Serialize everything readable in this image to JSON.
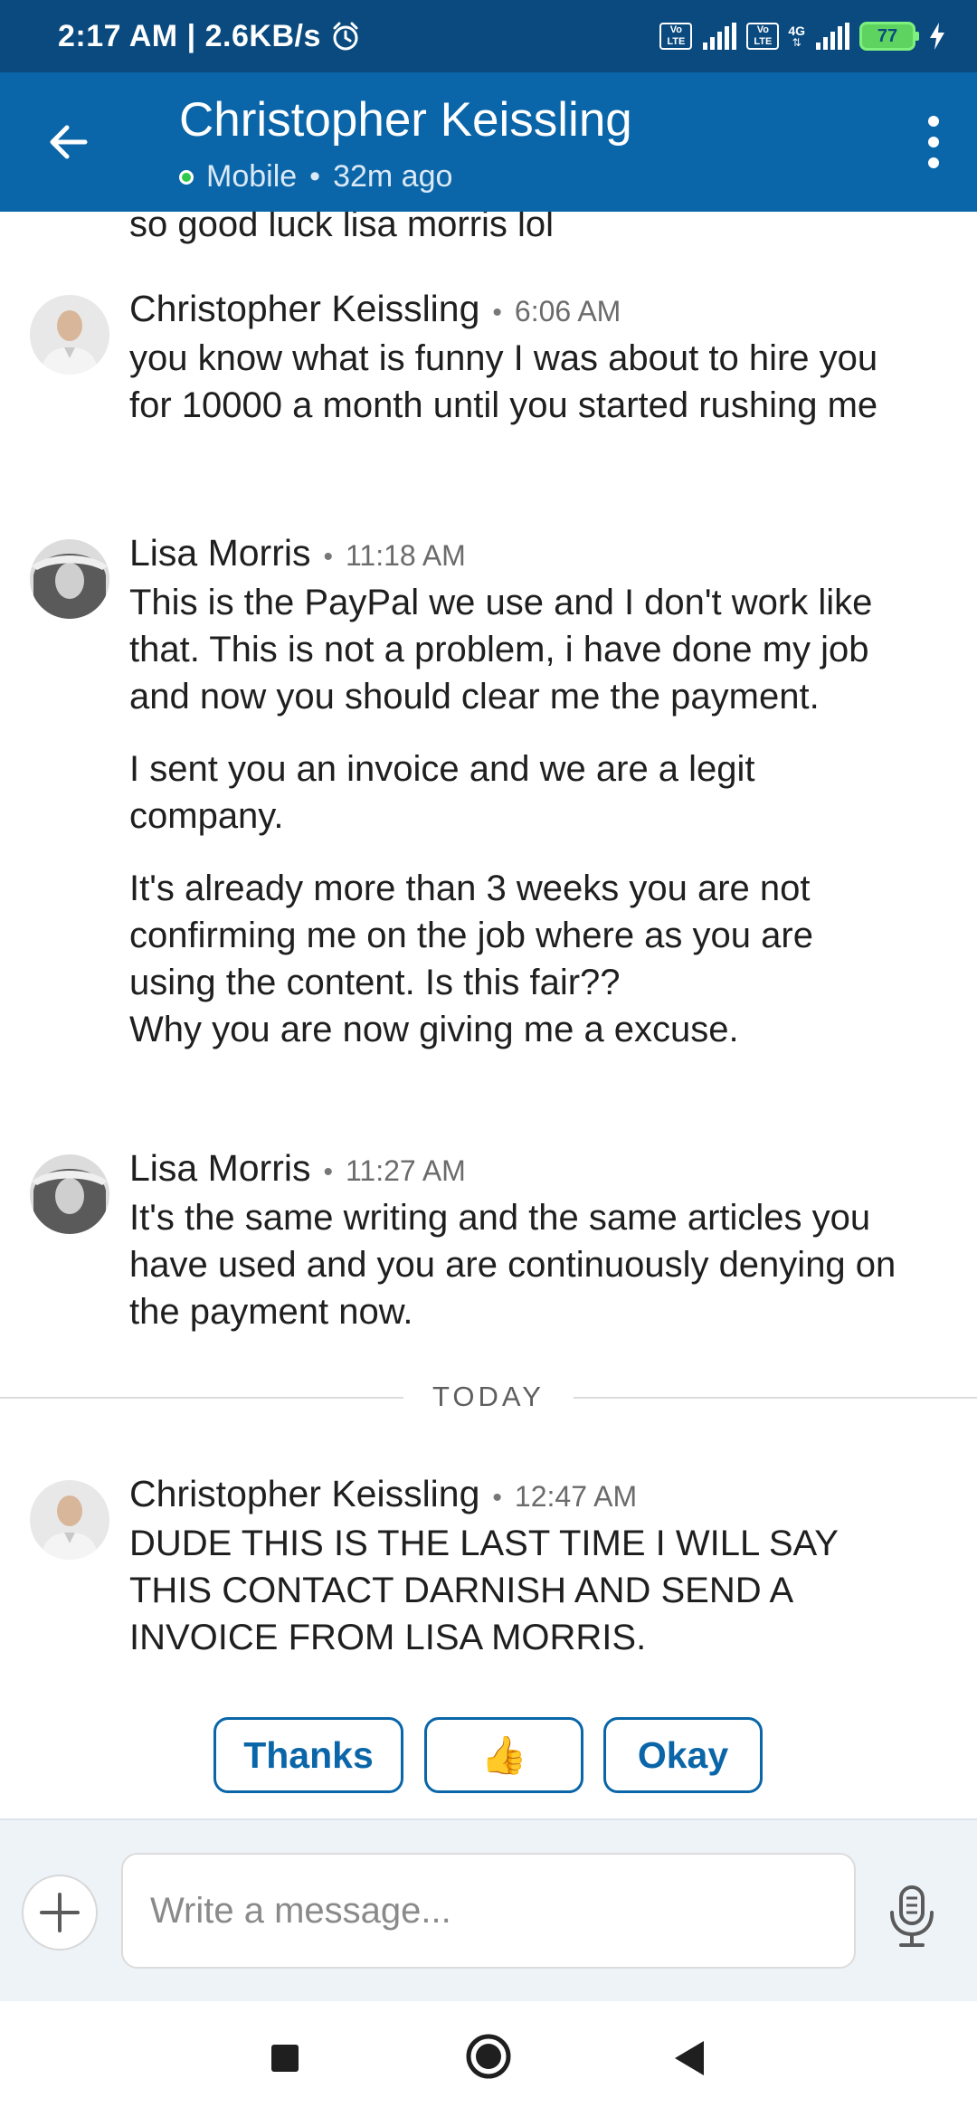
{
  "status_bar": {
    "time": "2:17 AM",
    "net_speed": "2.6KB/s",
    "sim1_label": "Vo LTE",
    "sim2_label": "Vo LTE",
    "network_type": "4G",
    "battery_level": "77"
  },
  "header": {
    "title": "Christopher Keissling",
    "presence": "Mobile",
    "last_seen": "32m ago",
    "presence_color": "#2ec94b"
  },
  "conversation": {
    "truncated_text": "so good luck lisa morris lol",
    "messages": [
      {
        "sender": "Christopher Keissling",
        "time": "6:06 AM",
        "paragraphs": [
          "you know what is funny I was about to hire you for 10000 a month until you started rushing me"
        ]
      },
      {
        "sender": "Lisa Morris",
        "time": "11:18 AM",
        "paragraphs": [
          "This is the PayPal we use and I don't work like that. This is not a problem, i have done my job and now you should clear me the payment.",
          "I sent you an invoice and we are a legit company.",
          "It's already more than 3 weeks you are not confirming me on the job where as you are using the content. Is this fair??\nWhy you are now giving me a excuse."
        ]
      },
      {
        "sender": "Lisa Morris",
        "time": "11:27 AM",
        "paragraphs": [
          "It's the same writing and the same articles you have used and you are continuously denying on the payment now."
        ]
      },
      {
        "sender": "Christopher Keissling",
        "time": "12:47 AM",
        "paragraphs": [
          "DUDE THIS IS THE LAST TIME I WILL SAY THIS CONTACT DARNISH AND SEND A INVOICE FROM LISA MORRIS."
        ]
      }
    ],
    "day_divider": "TODAY"
  },
  "quick_replies": {
    "thanks": "Thanks",
    "thumbs_up": "👍",
    "okay": "Okay"
  },
  "composer": {
    "placeholder": "Write a message..."
  },
  "colors": {
    "status_bar": "#0a4a7e",
    "header": "#0a66a8",
    "accent": "#0a66a8",
    "composer_bg": "#eef3f8"
  }
}
